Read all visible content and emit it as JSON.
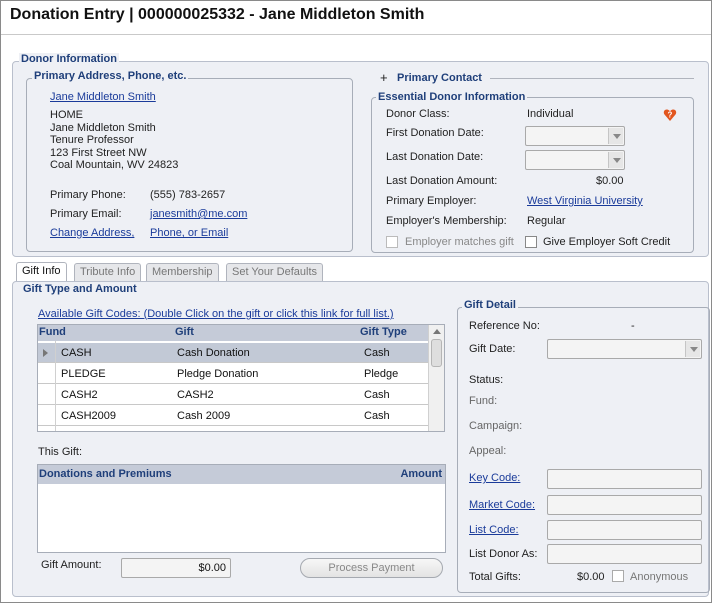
{
  "window": {
    "title": "Donation Entry | 000000025332 - Jane Middleton Smith"
  },
  "donor_info": {
    "section_title": "Donor Information",
    "primary_address": {
      "group_title": "Primary Address, Phone, etc.",
      "name_link": "Jane Middleton Smith",
      "address_lines": [
        "HOME",
        "Jane Middleton Smith",
        "Tenure Professor",
        "123 First Street NW",
        "Coal Mountain, WV 24823"
      ],
      "phone_label": "Primary Phone:",
      "phone_value": "(555) 783-2657",
      "email_label": "Primary Email:",
      "email_value": "janesmith@me.com",
      "change_address_link": "Change Address,",
      "change_phone_link": "Phone, or Email"
    },
    "primary_contact": {
      "toggle": "+",
      "label": "Primary Contact"
    },
    "essential": {
      "group_title": "Essential Donor Information",
      "donor_class_label": "Donor Class:",
      "donor_class_value": "Individual",
      "first_donation_label": "First Donation Date:",
      "last_donation_label": "Last Donation Date:",
      "last_amount_label": "Last Donation Amount:",
      "last_amount_value": "$0.00",
      "employer_label": "Primary Employer:",
      "employer_value": "West Virginia University",
      "membership_label": "Employer's Membership:",
      "membership_value": "Regular",
      "employer_matches_label": "Employer matches gift",
      "soft_credit_label": "Give Employer Soft Credit"
    }
  },
  "tabs": [
    "Gift Info",
    "Tribute Info",
    "Membership",
    "Set Your Defaults"
  ],
  "gift_type": {
    "section_title": "Gift Type and Amount",
    "codes_link": "Available Gift Codes: (Double Click on the gift or click this link for full list.)",
    "columns": [
      "Fund",
      "Gift",
      "Gift Type"
    ],
    "rows": [
      {
        "fund": "CASH",
        "gift": "Cash Donation",
        "type": "Cash"
      },
      {
        "fund": "PLEDGE",
        "gift": "Pledge Donation",
        "type": "Pledge"
      },
      {
        "fund": "CASH2",
        "gift": "CASH2",
        "type": "Cash"
      },
      {
        "fund": "CASH2009",
        "gift": "Cash 2009",
        "type": "Cash"
      }
    ],
    "this_gift_label": "This Gift:",
    "donations_header": "Donations and Premiums",
    "amount_header": "Amount",
    "gift_amount_label": "Gift Amount:",
    "gift_amount_value": "$0.00",
    "process_payment": "Process Payment"
  },
  "gift_detail": {
    "section_title": "Gift Detail",
    "reference_label": "Reference No:",
    "reference_value": "-",
    "gift_date_label": "Gift Date:",
    "status_label": "Status:",
    "fund_label": "Fund:",
    "campaign_label": "Campaign:",
    "appeal_label": "Appeal:",
    "key_code_label": "Key Code:",
    "market_code_label": "Market Code:",
    "list_code_label": "List Code:",
    "list_donor_as_label": "List Donor As:",
    "total_gifts_label": "Total Gifts:",
    "total_gifts_value": "$0.00",
    "anonymous_label": "Anonymous"
  },
  "colors": {
    "accent": "#1f3f7a",
    "link": "#1a3b9a",
    "panel": "#eef0f5",
    "selected_row": "#c2c9d6",
    "alert_icon": "#e2561f"
  }
}
